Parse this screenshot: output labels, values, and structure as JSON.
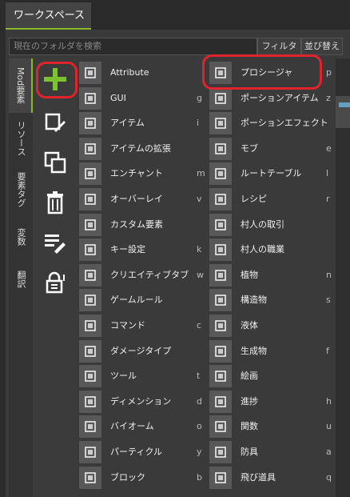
{
  "workspace_tab": "ワークスペース",
  "search": {
    "placeholder": "現在のフォルダを検索"
  },
  "filter_label": "フィルタ",
  "sort_label": "並び替え",
  "vertical_tabs": [
    "Mod要素",
    "リソース",
    "要素タグ",
    "変数",
    "翻訳"
  ],
  "tools": [
    "add-icon",
    "new-file-icon",
    "duplicate-icon",
    "delete-icon",
    "list-edit-icon",
    "lock-icon"
  ],
  "accent_color": "#8ab828",
  "highlight_color": "#e0242d",
  "left_items": [
    {
      "label": "Attribute",
      "key": "",
      "icon": "attribute-icon"
    },
    {
      "label": "GUI",
      "key": "g",
      "icon": "gui-icon"
    },
    {
      "label": "アイテム",
      "key": "i",
      "icon": "item-icon"
    },
    {
      "label": "アイテムの拡張",
      "key": "",
      "icon": "item-extension-icon"
    },
    {
      "label": "エンチャント",
      "key": "m",
      "icon": "enchant-icon"
    },
    {
      "label": "オーバーレイ",
      "key": "v",
      "icon": "overlay-icon"
    },
    {
      "label": "カスタム要素",
      "key": "",
      "icon": "custom-element-icon"
    },
    {
      "label": "キー設定",
      "key": "k",
      "icon": "keybind-icon"
    },
    {
      "label": "クリエイティブタブ",
      "key": "w",
      "icon": "creative-tab-icon"
    },
    {
      "label": "ゲームルール",
      "key": "",
      "icon": "gamerule-icon"
    },
    {
      "label": "コマンド",
      "key": "c",
      "icon": "command-icon"
    },
    {
      "label": "ダメージタイプ",
      "key": "",
      "icon": "damage-type-icon"
    },
    {
      "label": "ツール",
      "key": "t",
      "icon": "tool-icon"
    },
    {
      "label": "ディメンション",
      "key": "d",
      "icon": "dimension-icon"
    },
    {
      "label": "バイオーム",
      "key": "o",
      "icon": "biome-icon"
    },
    {
      "label": "パーティクル",
      "key": "y",
      "icon": "particle-icon"
    },
    {
      "label": "ブロック",
      "key": "b",
      "icon": "block-icon"
    }
  ],
  "right_items": [
    {
      "label": "プロシージャ",
      "key": "p",
      "icon": "procedure-icon"
    },
    {
      "label": "ポーションアイテム",
      "key": "z",
      "icon": "potion-item-icon"
    },
    {
      "label": "ポーションエフェクト",
      "key": "",
      "icon": "potion-effect-icon"
    },
    {
      "label": "モブ",
      "key": "e",
      "icon": "mob-icon"
    },
    {
      "label": "ルートテーブル",
      "key": "l",
      "icon": "loot-table-icon"
    },
    {
      "label": "レシピ",
      "key": "r",
      "icon": "recipe-icon"
    },
    {
      "label": "村人の取引",
      "key": "",
      "icon": "villager-trade-icon"
    },
    {
      "label": "村人の職業",
      "key": "",
      "icon": "villager-profession-icon"
    },
    {
      "label": "植物",
      "key": "n",
      "icon": "plant-icon"
    },
    {
      "label": "構造物",
      "key": "s",
      "icon": "structure-icon"
    },
    {
      "label": "液体",
      "key": "",
      "icon": "fluid-icon"
    },
    {
      "label": "生成物",
      "key": "f",
      "icon": "feature-icon"
    },
    {
      "label": "絵画",
      "key": "",
      "icon": "painting-icon"
    },
    {
      "label": "進捗",
      "key": "h",
      "icon": "advancement-icon"
    },
    {
      "label": "関数",
      "key": "u",
      "icon": "function-icon"
    },
    {
      "label": "防具",
      "key": "a",
      "icon": "armor-icon"
    },
    {
      "label": "飛び道具",
      "key": "q",
      "icon": "projectile-icon"
    }
  ]
}
